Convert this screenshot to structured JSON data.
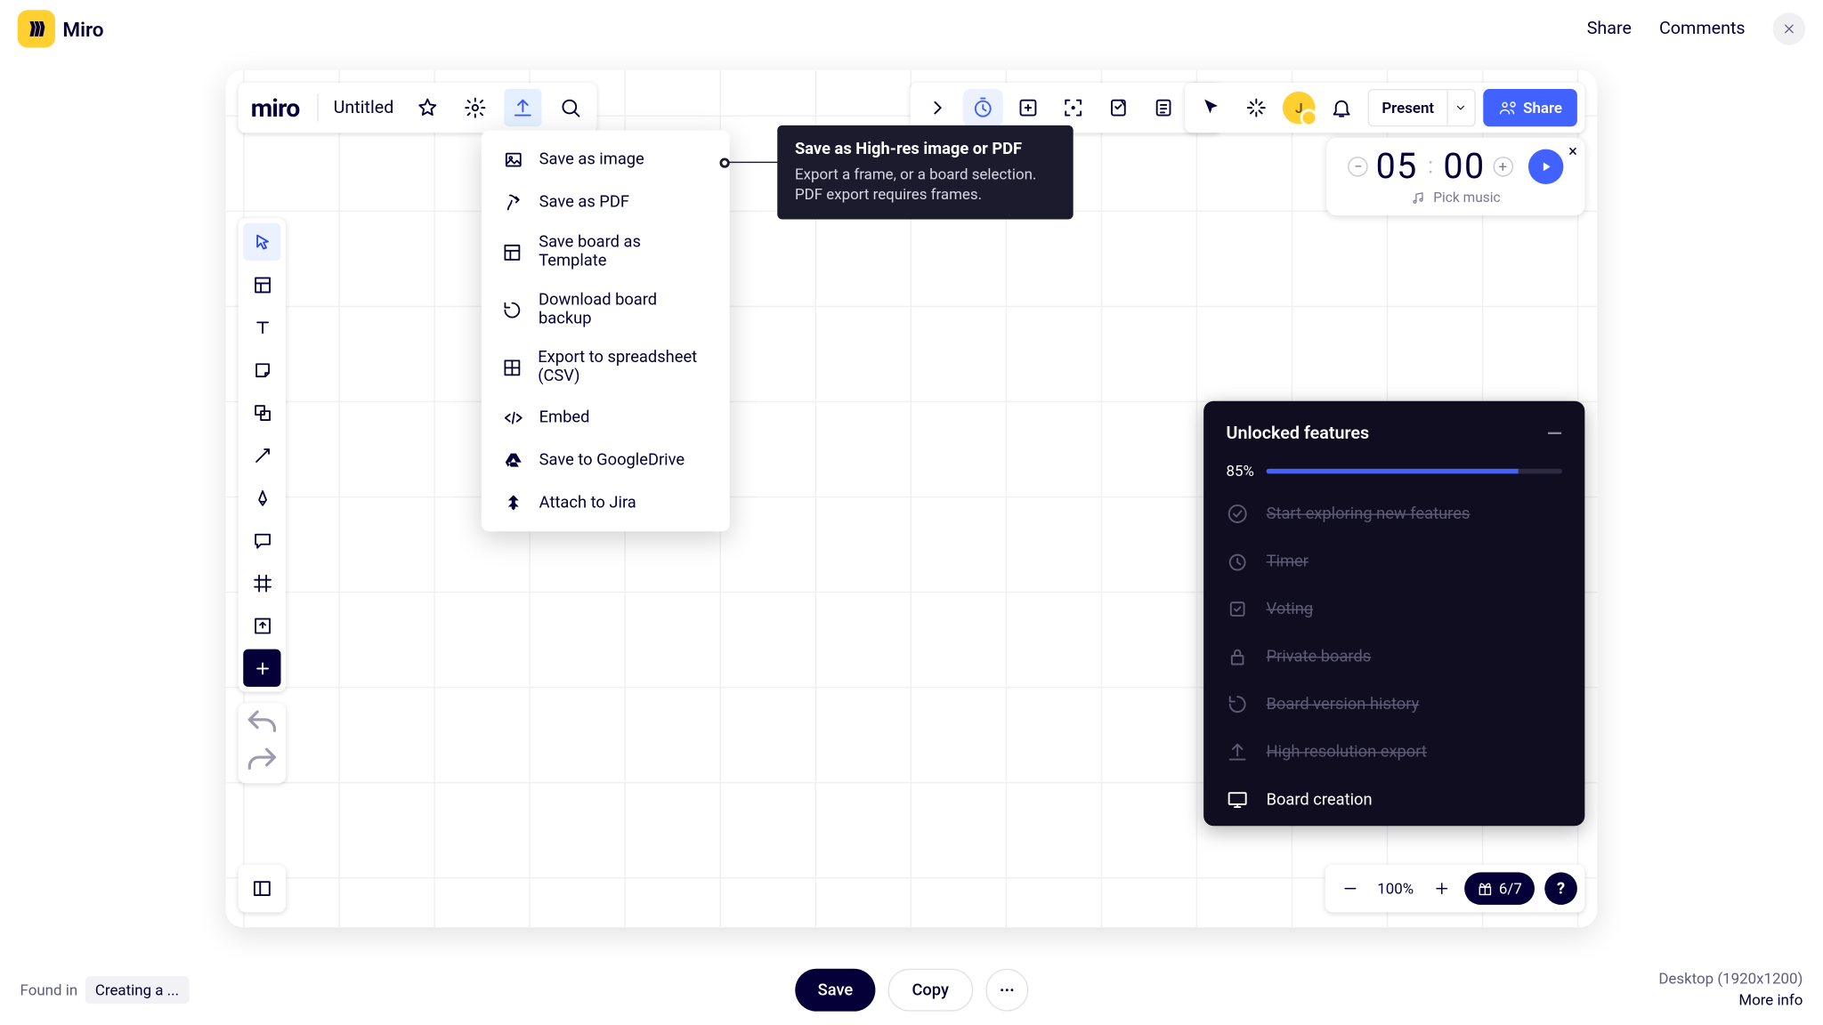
{
  "outer_header": {
    "brand": "Miro",
    "share": "Share",
    "comments": "Comments"
  },
  "board": {
    "logo_text": "miro",
    "name": "Untitled"
  },
  "present_label": "Present",
  "share_label": "Share",
  "export_menu": {
    "items": [
      "Save as image",
      "Save as PDF",
      "Save board as Template",
      "Download board backup",
      "Export to spreadsheet (CSV)",
      "Embed",
      "Save to GoogleDrive",
      "Attach to Jira"
    ]
  },
  "tooltip": {
    "title": "Save as High-res image or PDF",
    "body": "Export a frame, or a board selection. PDF export requires frames."
  },
  "timer": {
    "minutes": "05",
    "seconds": "00",
    "pick_music": "Pick music"
  },
  "features": {
    "title": "Unlocked features",
    "percent": "85%",
    "items": [
      {
        "label": "Start exploring new features",
        "done": true
      },
      {
        "label": "Timer",
        "done": true
      },
      {
        "label": "Voting",
        "done": true
      },
      {
        "label": "Private boards",
        "done": true
      },
      {
        "label": "Board version history",
        "done": true
      },
      {
        "label": "High resolution export",
        "done": true
      },
      {
        "label": "Board creation",
        "done": false
      }
    ]
  },
  "zoom": {
    "value": "100%",
    "counter": "6/7"
  },
  "footer": {
    "found_in": "Found in",
    "source": "Creating a ...",
    "save": "Save",
    "copy": "Copy",
    "resolution": "Desktop (1920x1200)",
    "more": "More info"
  }
}
